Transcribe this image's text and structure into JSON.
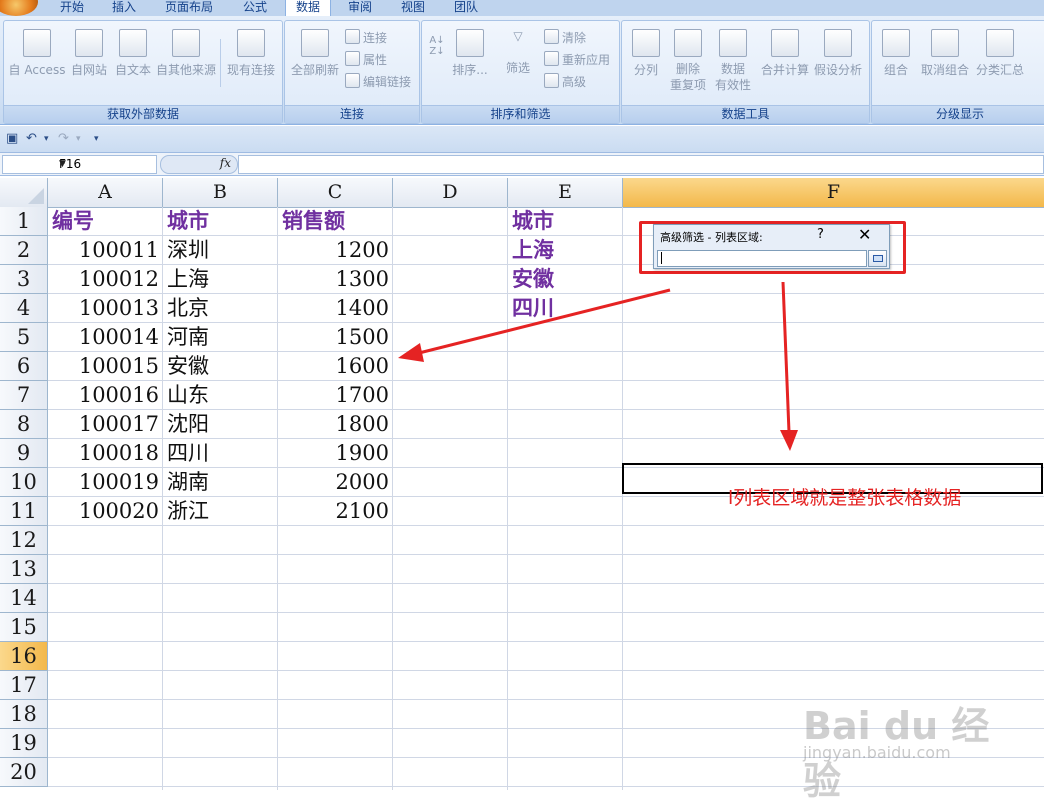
{
  "ribbon_tabs": [
    "开始",
    "插入",
    "页面布局",
    "公式",
    "数据",
    "审阅",
    "视图",
    "团队"
  ],
  "active_tab": "数据",
  "groups": {
    "get_external": {
      "label": "获取外部数据",
      "buttons": [
        "自 Access",
        "自网站",
        "自文本",
        "自其他来源",
        "现有连接"
      ]
    },
    "connections": {
      "label": "连接",
      "refresh_all": "全部刷新",
      "small": [
        "连接",
        "属性",
        "编辑链接"
      ]
    },
    "sort_filter": {
      "label": "排序和筛选",
      "sort": "排序...",
      "filter": "筛选",
      "small": [
        "清除",
        "重新应用",
        "高级"
      ]
    },
    "data_tools": {
      "label": "数据工具",
      "buttons": [
        "分列",
        "删除\n重复项",
        "数据\n有效性",
        "合并计算",
        "假设分析"
      ]
    },
    "outline": {
      "label": "分级显示",
      "buttons": [
        "组合",
        "取消组合",
        "分类汇总"
      ]
    }
  },
  "formula_bar": {
    "name_box": "F16",
    "fx": "fx",
    "formula": ""
  },
  "columns": [
    "A",
    "B",
    "C",
    "D",
    "E",
    "F"
  ],
  "selected_column": "F",
  "rows": [
    "1",
    "2",
    "3",
    "4",
    "5",
    "6",
    "7",
    "8",
    "9",
    "10",
    "11",
    "12",
    "13",
    "14",
    "15",
    "16",
    "17",
    "18",
    "19",
    "20"
  ],
  "selected_row": "16",
  "table": {
    "headers": [
      "编号",
      "城市",
      "销售额"
    ],
    "records": [
      [
        "100011",
        "深圳",
        "1200"
      ],
      [
        "100012",
        "上海",
        "1300"
      ],
      [
        "100013",
        "北京",
        "1400"
      ],
      [
        "100014",
        "河南",
        "1500"
      ],
      [
        "100015",
        "安徽",
        "1600"
      ],
      [
        "100016",
        "山东",
        "1700"
      ],
      [
        "100017",
        "沈阳",
        "1800"
      ],
      [
        "100018",
        "四川",
        "1900"
      ],
      [
        "100019",
        "湖南",
        "2000"
      ],
      [
        "100020",
        "浙江",
        "2100"
      ]
    ]
  },
  "criteria": {
    "header": "城市",
    "values": [
      "上海",
      "安徽",
      "四川"
    ]
  },
  "dialog": {
    "title": "高级筛选 - 列表区域:",
    "help": "?",
    "close": "✕",
    "value": ""
  },
  "annotation": "l列表区域就是整张表格数据",
  "annotation_color": "#e52323",
  "watermark": {
    "brand": "Bai du 经验",
    "url": "jingyan.baidu.com"
  }
}
